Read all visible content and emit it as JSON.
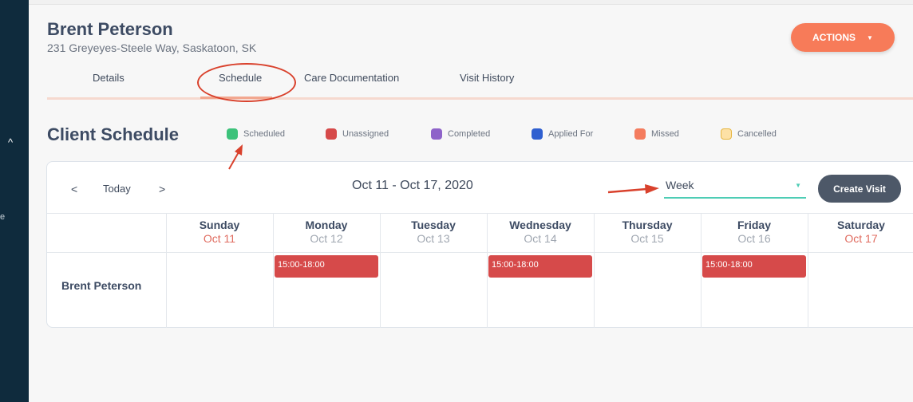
{
  "sidebar": {
    "caret": "^",
    "cut_letter": "e"
  },
  "client": {
    "name": "Brent Peterson",
    "address": "231 Greyeyes-Steele Way, Saskatoon, SK"
  },
  "actions": {
    "label": "ACTIONS",
    "icon": "caret-down-icon"
  },
  "tabs": [
    {
      "label": "Details"
    },
    {
      "label": "Schedule",
      "active": true
    },
    {
      "label": "Care Documentation"
    },
    {
      "label": "Visit History"
    }
  ],
  "schedule": {
    "title": "Client Schedule",
    "legend": [
      {
        "label": "Scheduled",
        "color": "#3cc27a"
      },
      {
        "label": "Unassigned",
        "color": "#d64a4a"
      },
      {
        "label": "Completed",
        "color": "#8e63c9"
      },
      {
        "label": "Applied For",
        "color": "#2f5fd0"
      },
      {
        "label": "Missed",
        "color": "#f47c5e"
      },
      {
        "label": "Cancelled",
        "color": "#fde1a6"
      }
    ]
  },
  "calendar": {
    "prev_icon": "<",
    "today_label": "Today",
    "next_icon": ">",
    "date_range": "Oct 11 - Oct 17, 2020",
    "view": "Week",
    "create_label": "Create Visit",
    "days": [
      {
        "name": "Sunday",
        "date": "Oct 11",
        "weekend": true
      },
      {
        "name": "Monday",
        "date": "Oct 12",
        "weekend": false
      },
      {
        "name": "Tuesday",
        "date": "Oct 13",
        "weekend": false
      },
      {
        "name": "Wednesday",
        "date": "Oct 14",
        "weekend": false
      },
      {
        "name": "Thursday",
        "date": "Oct 15",
        "weekend": false
      },
      {
        "name": "Friday",
        "date": "Oct 16",
        "weekend": false
      },
      {
        "name": "Saturday",
        "date": "Oct 17",
        "weekend": true
      }
    ],
    "row_label": "Brent Peterson",
    "visits": [
      {
        "day": "Monday",
        "time": "15:00-18:00",
        "status": "Unassigned"
      },
      {
        "day": "Wednesday",
        "time": "15:00-18:00",
        "status": "Unassigned"
      },
      {
        "day": "Friday",
        "time": "15:00-18:00",
        "status": "Unassigned"
      }
    ]
  },
  "annotation_color": "#d9412c"
}
